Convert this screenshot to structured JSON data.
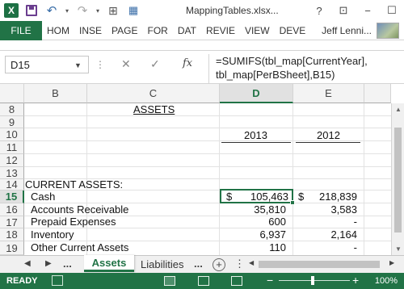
{
  "window": {
    "title": "MappingTables.xlsx...",
    "help": "?",
    "restore_ribbon": "⊡",
    "minimize": "−",
    "maximize": "☐"
  },
  "ribbon": {
    "file": "FILE",
    "tabs": [
      "HOM",
      "INSE",
      "PAGE",
      "FOR",
      "DAT",
      "REVIE",
      "VIEW",
      "DEVE"
    ],
    "user": "Jeff Lenni..."
  },
  "formula_bar": {
    "name_box": "D15",
    "formula_line1": "=SUMIFS(tbl_map[CurrentYear],",
    "formula_line2": "tbl_map[PerBSheet],B15)"
  },
  "columns": [
    "B",
    "C",
    "D",
    "E"
  ],
  "rows": [
    "8",
    "9",
    "10",
    "11",
    "12",
    "13",
    "14",
    "15",
    "16",
    "17",
    "18",
    "19"
  ],
  "sheet": {
    "heading": "ASSETS",
    "year_current": "2013",
    "year_prior": "2012",
    "section": "CURRENT ASSETS:",
    "cash_label": "Cash",
    "cash_cur_symbol": "$",
    "cash_cur": "105,463",
    "cash_prior_symbol": "$",
    "cash_prior": "218,839",
    "ar_label": "Accounts Receivable",
    "ar_cur": "35,810",
    "ar_prior": "3,583",
    "prepaid_label": "Prepaid Expenses",
    "prepaid_cur": "600",
    "prepaid_prior": "-",
    "inventory_label": "Inventory",
    "inventory_cur": "6,937",
    "inventory_prior": "2,164",
    "other_label": "Other Current Assets",
    "other_cur": "110",
    "other_prior": "-"
  },
  "tabs": {
    "ellipsis": "...",
    "active": "Assets",
    "other": "Liabilities",
    "more": "..."
  },
  "status": {
    "ready": "READY",
    "zoom_minus": "−",
    "zoom_plus": "+",
    "zoom": "100%"
  },
  "colors": {
    "excel_green": "#217346",
    "status_bar": "#217346"
  }
}
